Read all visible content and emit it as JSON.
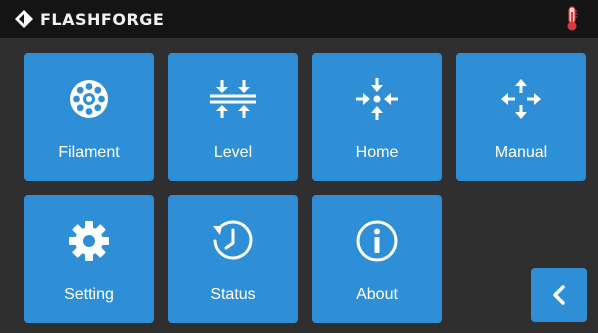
{
  "header": {
    "brand": "FLASHFORGE",
    "logo_icon": "flashforge-logo-icon",
    "thermometer_icon": "thermometer-icon",
    "accent_color": "#2f8fd6",
    "thermometer_color": "#d63a3a"
  },
  "menu": {
    "filament": {
      "label": "Filament",
      "icon": "filament-spool-icon"
    },
    "level": {
      "label": "Level",
      "icon": "level-arrows-icon"
    },
    "home": {
      "label": "Home",
      "icon": "home-arrows-icon"
    },
    "manual": {
      "label": "Manual",
      "icon": "move-arrows-icon"
    },
    "setting": {
      "label": "Setting",
      "icon": "gear-icon"
    },
    "status": {
      "label": "Status",
      "icon": "clock-history-icon"
    },
    "about": {
      "label": "About",
      "icon": "info-icon"
    }
  },
  "back_button": {
    "icon": "chevron-left-icon"
  }
}
